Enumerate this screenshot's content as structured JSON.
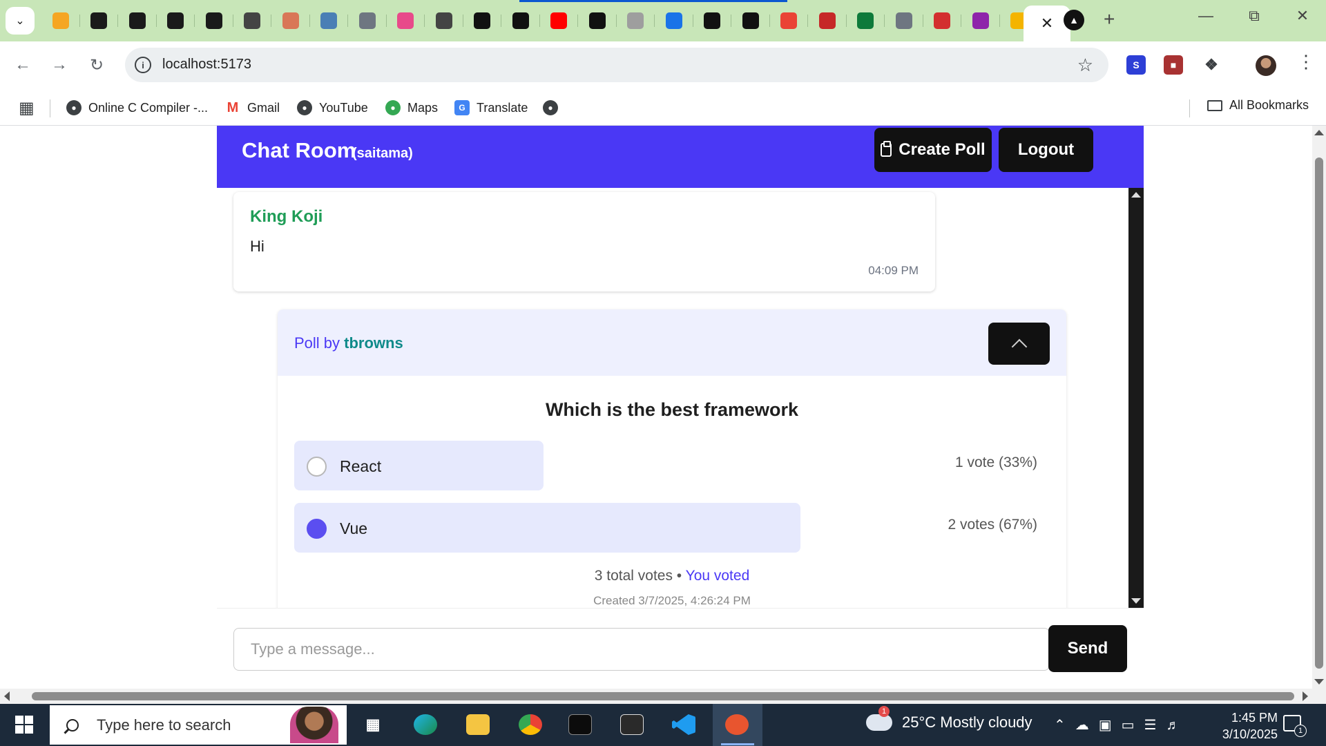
{
  "browser": {
    "url": "localhost:5173",
    "tab_favicons": [
      "mail-orange-icon",
      "bolt-icon",
      "bolt-icon",
      "bolt-icon",
      "bolt-icon",
      "openai-icon",
      "claude-icon",
      "infinity-icon",
      "github-icon",
      "colorwheel-icon",
      "openai-dark-icon",
      "vercel-icon",
      "vite-icon",
      "youtube-icon",
      "bolt-icon",
      "globe-icon",
      "house-icon",
      "notion-icon",
      "terminal-icon",
      "arrow-icon",
      "chart-icon",
      "v-icon",
      "github-icon",
      "stripe-icon",
      "puzzle-icon",
      "windows-tiles-icon"
    ],
    "tab_colors": [
      "#f5a623",
      "#1a1a1a",
      "#1a1a1a",
      "#1a1a1a",
      "#1a1a1a",
      "#444444",
      "#d97757",
      "#4a7fb5",
      "#6e7681",
      "#e84a8a",
      "#444444",
      "#111111",
      "#111111",
      "#ff0000",
      "#111111",
      "#9e9e9e",
      "#1a73e8",
      "#111111",
      "#111111",
      "#ea4335",
      "#c62828",
      "#0e7a3a",
      "#6e7681",
      "#d32f2f",
      "#8e24aa",
      "#f4b400"
    ],
    "bookmarks": [
      {
        "label": "Online C Compiler -...",
        "icon": "globe-icon"
      },
      {
        "label": "Gmail",
        "icon": "gmail-icon"
      },
      {
        "label": "YouTube",
        "icon": "globe-icon"
      },
      {
        "label": "Maps",
        "icon": "maps-pin-icon"
      },
      {
        "label": "Translate",
        "icon": "translate-icon"
      }
    ],
    "all_bookmarks": "All Bookmarks"
  },
  "app": {
    "title": "Chat Room",
    "username": "(saitama)",
    "create_poll": "Create Poll",
    "logout": "Logout",
    "accent": "#4a38f5"
  },
  "messages": [
    {
      "author": "King Koji",
      "text": "Hi",
      "time": "04:09 PM"
    }
  ],
  "poll": {
    "by_prefix": "Poll by",
    "owner": "tbrowns",
    "question": "Which is the best framework",
    "options": [
      {
        "label": "React",
        "votes_text": "1 vote (33%)",
        "selected": false,
        "share": 0.33
      },
      {
        "label": "Vue",
        "votes_text": "2 votes (67%)",
        "selected": true,
        "share": 0.67
      }
    ],
    "total": "3 total votes •",
    "voted": "You voted",
    "created": "Created 3/7/2025, 4:26:24 PM"
  },
  "composer": {
    "placeholder": "Type a message...",
    "send": "Send"
  },
  "taskbar": {
    "search_placeholder": "Type here to search",
    "weather": "25°C  Mostly cloudy",
    "weather_badge": "1",
    "time": "1:45 PM",
    "date": "3/10/2025",
    "notifications": "1"
  }
}
